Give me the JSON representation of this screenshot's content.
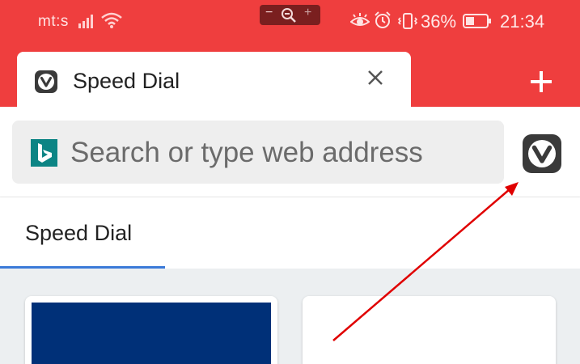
{
  "status_bar": {
    "carrier": "mt:s",
    "battery_percent": "36%",
    "time": "21:34",
    "zoom_controls": {
      "minus": "−",
      "plus": "+"
    },
    "icons": [
      "signal-icon",
      "wifi-icon",
      "zoom-icon",
      "eye-comfort-icon",
      "alarm-icon",
      "vibrate-icon",
      "battery-icon"
    ]
  },
  "tab": {
    "title": "Speed Dial",
    "favicon": "vivaldi-icon",
    "close_icon": "close-icon",
    "new_tab_icon": "plus-icon"
  },
  "address_bar": {
    "placeholder": "Search or type web address",
    "search_engine_icon": "bing-icon",
    "menu_icon": "vivaldi-icon"
  },
  "subtabs": [
    {
      "label": "Speed Dial",
      "active": true
    }
  ],
  "speed_dial_tiles": [
    {
      "thumbnail_color": "#003078"
    },
    {
      "thumbnail_color": "#ffffff"
    }
  ],
  "colors": {
    "accent": "#ef3e3e",
    "active_tab_indicator": "#3b7ad8",
    "annotation_arrow": "#e00000",
    "bing": "#0c8484",
    "vivaldi_icon": "#3a3a3a"
  }
}
